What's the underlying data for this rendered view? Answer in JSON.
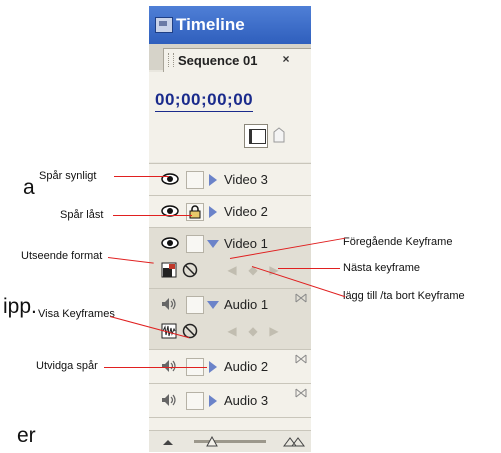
{
  "panel": {
    "title": "Timeline",
    "sequence_tab": "Sequence 01",
    "tab_close": "×",
    "timecode": "00;00;00;00"
  },
  "tracks": [
    {
      "name": "Video 3"
    },
    {
      "name": "Video 2"
    },
    {
      "name": "Video 1"
    },
    {
      "name": "Audio 1"
    },
    {
      "name": "Audio 2"
    },
    {
      "name": "Audio 3"
    }
  ],
  "annotations": {
    "spar_synligt": "Spår synligt",
    "spar_last": "Spår låst",
    "utseende_format": "Utseende format",
    "visa_keyframes": "Visa Keyframes",
    "utvidga_spar": "Utvidga spår",
    "foregaende_keyframe": "Föregående Keyframe",
    "nasta_keyframe": "Nästa keyframe",
    "lagg_till": "lägg till /ta bort Keyframe"
  },
  "background_text": {
    "a": "a",
    "ipp": "ipp.",
    "er": "er"
  },
  "colors": {
    "title_bar": "#3a6ccc",
    "timecode": "#1a2b8c",
    "track_triangle": "#6b83c9",
    "annotation_line": "#e02020"
  }
}
